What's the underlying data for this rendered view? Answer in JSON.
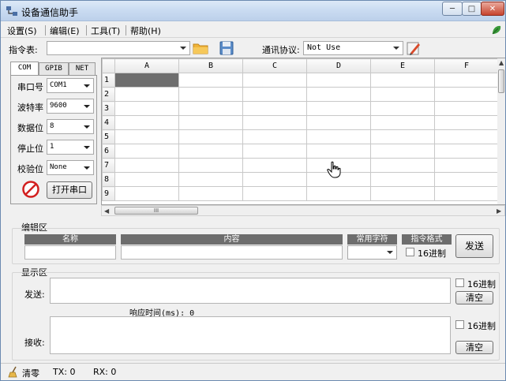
{
  "window": {
    "title": "设备通信助手",
    "minimize_glyph": "─",
    "maximize_glyph": "□",
    "close_glyph": "✕"
  },
  "menu": {
    "items": [
      "设置(S)",
      "编辑(E)",
      "工具(T)",
      "帮助(H)"
    ]
  },
  "toolbar": {
    "command_table_label": "指令表:",
    "command_table_value": "",
    "protocol_label": "通讯协议:",
    "protocol_value": "Not Use"
  },
  "tabs": [
    "COM",
    "GPIB",
    "NET"
  ],
  "serial": {
    "fields": [
      {
        "label": "串口号",
        "value": "COM1"
      },
      {
        "label": "波特率",
        "value": "9600"
      },
      {
        "label": "数据位",
        "value": "8"
      },
      {
        "label": "停止位",
        "value": "1"
      },
      {
        "label": "校验位",
        "value": "None"
      }
    ],
    "open_button": "打开串口"
  },
  "grid": {
    "columns": [
      "A",
      "B",
      "C",
      "D",
      "E",
      "F"
    ],
    "rows": [
      "1",
      "2",
      "3",
      "4",
      "5",
      "6",
      "7",
      "8",
      "9"
    ],
    "selected_cell": "A1",
    "hscroll_grip": "III"
  },
  "edit_area": {
    "title": "编辑区",
    "col_name": "名称",
    "col_content": "内容",
    "col_common": "常用字符",
    "col_format": "指令格式",
    "hex_label": "16进制",
    "send_button": "发送"
  },
  "display_area": {
    "title": "显示区",
    "send_label": "发送:",
    "hex_label_send": "16进制",
    "clear_button": "清空",
    "response_time_label": "响应时间(ms): 0",
    "receive_label": "接收:",
    "hex_label_receive": "16进制",
    "clear_button_2": "清空"
  },
  "status": {
    "clear_label": "清零",
    "tx": "TX: 0",
    "rx": "RX: 0"
  },
  "colors": {
    "title_bar": "#c9dbf1",
    "close_button": "#c7432e",
    "selected_cell": "#6e6e6e",
    "header_bar": "#6d6d6d"
  }
}
